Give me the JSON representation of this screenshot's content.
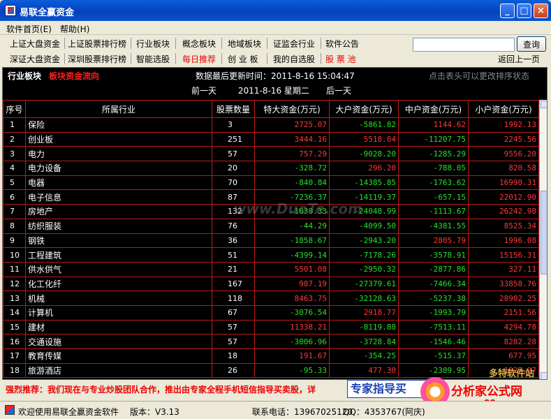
{
  "window": {
    "title": "易联全赢资金",
    "minimize": "_",
    "maximize": "□",
    "close": "×"
  },
  "menu": {
    "items": [
      "软件首页(E)",
      "帮助(H)"
    ]
  },
  "toolbar": {
    "row1": [
      "上证大盘资金",
      "上证股票排行榜",
      "行业板块",
      "概念板块",
      "地域板块",
      "证监会行业",
      "软件公告"
    ],
    "row2": [
      "深证大盘资金",
      "深圳股票排行榜",
      "智能选股",
      "每日推荐",
      "创 业 板",
      "我的自选股",
      "股 票 池"
    ],
    "search_button": "查询",
    "search_value": "",
    "back": "返回上一页"
  },
  "panel": {
    "section": "行业板块",
    "subsection": "板块资金流向",
    "update_time": "数据最后更新时间：2011-8-16 15:04:47",
    "hint": "点击表头可以更改排序状态",
    "prev_day": "前一天",
    "date": "2011-8-16 星期二",
    "next_day": "后一天"
  },
  "table": {
    "headers": [
      "序号",
      "所属行业",
      "股票数量",
      "特大资金(万元)",
      "大户资金(万元)",
      "中户资金(万元)",
      "小户资金(万元)"
    ],
    "rows": [
      [
        "1",
        "保险",
        "3",
        "2725.07",
        "-5861.82",
        "1144.62",
        "1992.13"
      ],
      [
        "2",
        "创业板",
        "251",
        "3444.16",
        "5518.04",
        "-11207.75",
        "2245.56"
      ],
      [
        "3",
        "电力",
        "57",
        "757.29",
        "-9028.20",
        "-1285.29",
        "9556.20"
      ],
      [
        "4",
        "电力设备",
        "20",
        "-328.72",
        "296.20",
        "-788.05",
        "820.58"
      ],
      [
        "5",
        "电器",
        "70",
        "-840.84",
        "-14385.85",
        "-1763.62",
        "16990.31"
      ],
      [
        "6",
        "电子信息",
        "87",
        "-7236.37",
        "-14119.37",
        "-657.15",
        "22012.90"
      ],
      [
        "7",
        "房地产",
        "132",
        "-1030.33",
        "-24048.99",
        "-1113.67",
        "26242.98"
      ],
      [
        "8",
        "纺织服装",
        "76",
        "-44.29",
        "-4099.50",
        "-4381.55",
        "8525.34"
      ],
      [
        "9",
        "钢铁",
        "36",
        "-1858.67",
        "-2943.20",
        "2805.79",
        "1996.08"
      ],
      [
        "10",
        "工程建筑",
        "51",
        "-4399.14",
        "-7178.26",
        "-3578.91",
        "15156.31"
      ],
      [
        "11",
        "供水供气",
        "21",
        "5501.08",
        "-2950.32",
        "-2877.86",
        "327.11"
      ],
      [
        "12",
        "化工化纤",
        "167",
        "987.19",
        "-27379.61",
        "-7466.34",
        "33858.76"
      ],
      [
        "13",
        "机械",
        "118",
        "8463.75",
        "-32128.63",
        "-5237.38",
        "28902.25"
      ],
      [
        "14",
        "计算机",
        "67",
        "-3076.54",
        "2918.77",
        "-1993.79",
        "2151.56"
      ],
      [
        "15",
        "建材",
        "57",
        "11338.21",
        "-8119.88",
        "-7513.11",
        "4294.78"
      ],
      [
        "16",
        "交通设施",
        "57",
        "-3006.96",
        "-3728.84",
        "-1546.46",
        "8282.28"
      ],
      [
        "17",
        "教育传媒",
        "18",
        "191.67",
        "-354.25",
        "-515.37",
        "677.95"
      ],
      [
        "18",
        "旅游酒店",
        "26",
        "-95.33",
        "477.30",
        "-2309.95",
        "1927.97"
      ]
    ]
  },
  "watermark": "www.DuoTe.com",
  "banner": {
    "label": "强烈推荐：",
    "text": "我们现在与专业炒股团队合作，推出由专家全程手机短信指导买卖股，详"
  },
  "expert_box": "专家指导买",
  "logo": {
    "name": "分析家公式网",
    "url": "www.88gs.com",
    "mark": "多特软件站"
  },
  "status": {
    "welcome": "欢迎使用易联全赢资金软件",
    "version": "版本：V3.13",
    "phone": "联系电话：13967025120",
    "qq": "QQ：4353767(阿庆)"
  }
}
